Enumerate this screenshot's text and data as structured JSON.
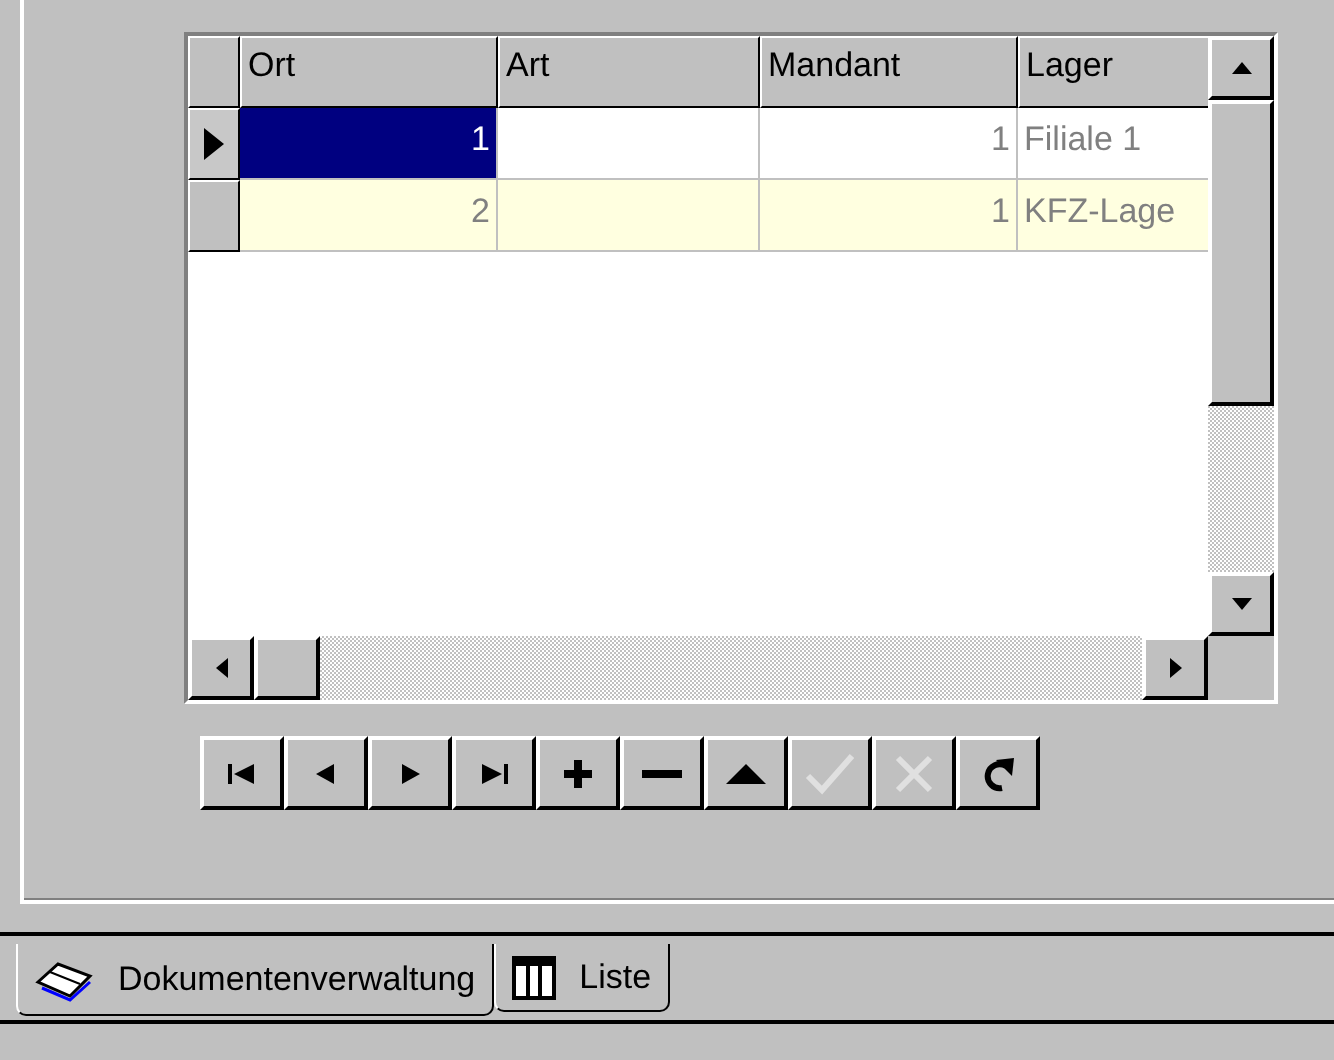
{
  "grid": {
    "columns": [
      "Ort",
      "Art",
      "Mandant",
      "Lager"
    ],
    "rows": [
      {
        "selected": true,
        "cells": [
          "1",
          "",
          "1",
          "Filiale 1"
        ]
      },
      {
        "selected": false,
        "cells": [
          "2",
          "",
          "1",
          "KFZ-Lage"
        ]
      }
    ]
  },
  "navigator": [
    {
      "kind": "first",
      "disabled": false
    },
    {
      "kind": "prior",
      "disabled": false
    },
    {
      "kind": "next",
      "disabled": false
    },
    {
      "kind": "last",
      "disabled": false
    },
    {
      "kind": "insert",
      "disabled": false
    },
    {
      "kind": "delete",
      "disabled": false
    },
    {
      "kind": "edit",
      "disabled": false
    },
    {
      "kind": "post",
      "disabled": true
    },
    {
      "kind": "cancel",
      "disabled": true
    },
    {
      "kind": "refresh",
      "disabled": false
    }
  ],
  "tabs": [
    {
      "label": "Dokumentenverwaltung",
      "selected": true
    },
    {
      "label": "Liste",
      "selected": false
    }
  ]
}
